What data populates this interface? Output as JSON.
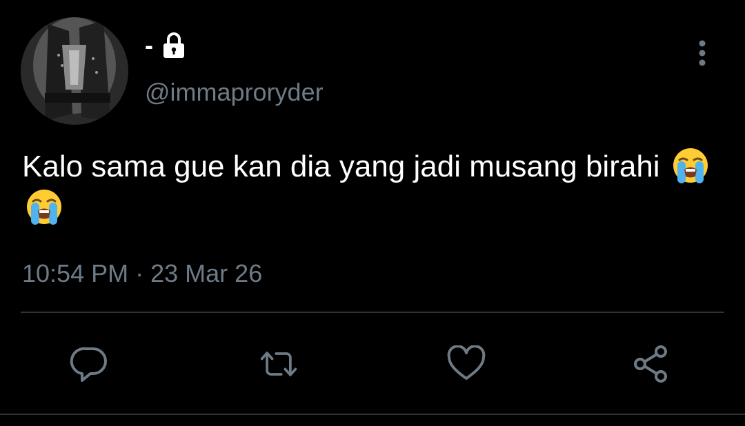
{
  "author": {
    "display_name": "-",
    "handle": "@immaproryder",
    "protected": true,
    "avatar": "avatar"
  },
  "tweet": {
    "text": "Kalo sama gue kan dia yang jadi musang birahi",
    "emojis": [
      "loudly-crying-face",
      "loudly-crying-face"
    ],
    "time": "10:54 PM",
    "separator": "·",
    "date": "23 Mar 26"
  },
  "actions": {
    "reply_icon": "reply-icon",
    "retweet_icon": "retweet-icon",
    "like_icon": "heart-icon",
    "share_icon": "share-icon",
    "more_icon": "more-vertical-icon"
  },
  "colors": {
    "background": "#000000",
    "text": "#ffffff",
    "secondary": "#6e7b86",
    "divider": "#2f3336"
  }
}
